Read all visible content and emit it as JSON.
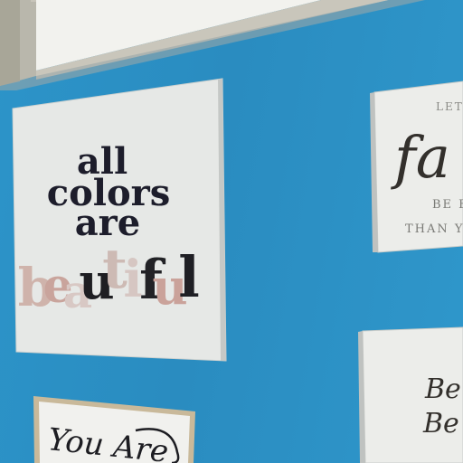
{
  "scene": {
    "wall_color": "#2a8fc4",
    "signs": {
      "main": {
        "lines": [
          "all",
          "colors",
          "are"
        ],
        "word": "beautiful",
        "letters": [
          "b",
          "e",
          "a",
          "u",
          "t",
          "i",
          "f",
          "u",
          "l"
        ],
        "letter_colors": [
          "#cfb3ab",
          "#c9a49c",
          "#d8c8c4",
          "#1e1e22",
          "#cdbab4",
          "#d6c6c2",
          "#222226",
          "#caa29a",
          "#1f1f24"
        ]
      },
      "right_top": {
        "line1": "LET",
        "script": "fa",
        "line2": "BE E",
        "line3": "THAN Y"
      },
      "right_bottom": {
        "script1": "Be",
        "script2": "Be"
      },
      "bottom_left": {
        "script": "You Are"
      }
    }
  }
}
